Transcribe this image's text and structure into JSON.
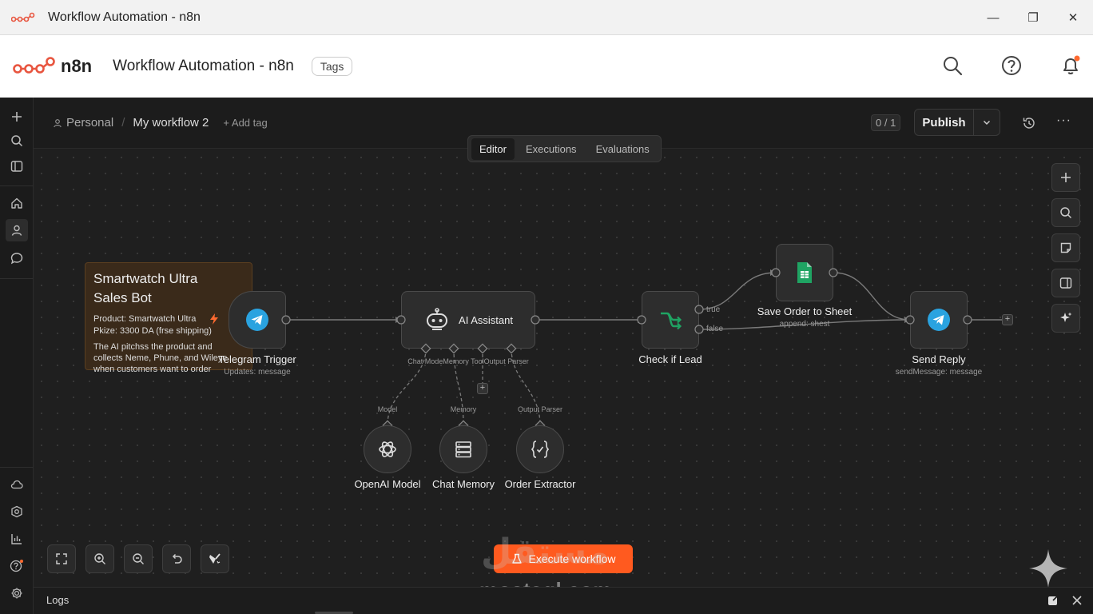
{
  "window": {
    "title": "Workflow Automation - n8n",
    "controls": [
      "minimize",
      "maximize",
      "close"
    ]
  },
  "app_header": {
    "brand": "n8n",
    "title": "Workflow Automation - n8n",
    "tags_button": "Tags",
    "icons": [
      "search-icon",
      "help-icon",
      "bell-icon"
    ]
  },
  "sidebar": {
    "top_icons": [
      "plus-icon",
      "search-icon",
      "panel-icon",
      "home-icon",
      "user-icon",
      "chat-icon"
    ],
    "bottom_icons": [
      "cloud-icon",
      "templates-icon",
      "insights-icon",
      "help-icon",
      "settings-icon"
    ]
  },
  "topbar": {
    "breadcrumb_owner": "Personal",
    "breadcrumb_sep": "/",
    "workflow_name": "My workflow 2",
    "add_tag": "+ Add tag",
    "counter": "0 / 1",
    "publish": "Publish",
    "more": "···"
  },
  "tabs": [
    "Editor",
    "Executions",
    "Evaluations"
  ],
  "active_tab": "Editor",
  "sticky_note": {
    "title": "Smartwatch Ultra Sales Bot",
    "line1": "Product: Smartwatch Ultra",
    "line2": "Pkize: 3300 DA (frse shipping)",
    "line3": "The AI pitchss the product and collects Neme, Phune, and Wileye when customers want to order"
  },
  "nodes": {
    "telegram_trigger": {
      "label": "Telegram Trigger",
      "sub": "Updates: message"
    },
    "ai_assistant": {
      "label": "AI Assistant",
      "ports": "Chat ModeMemory   ToolOutput Parser"
    },
    "check_if_lead": {
      "label": "Check if Lead",
      "true": "true",
      "false": "false"
    },
    "save_order": {
      "label": "Save Order to Sheet",
      "sub": "append: shest"
    },
    "send_reply": {
      "label": "Send Reply",
      "sub": "sendMessage: message"
    },
    "openai_model": {
      "label": "OpenAI Model",
      "port": "Model"
    },
    "chat_memory": {
      "label": "Chat Memory",
      "port": "Memory"
    },
    "order_extractor": {
      "label": "Order Extractor",
      "port": "Output Parser"
    }
  },
  "plus": "+",
  "execute_button": "Execute workflow",
  "watermark": {
    "arabic": "مستقل",
    "latin": "mostaql.com"
  },
  "logs": "Logs",
  "colors": {
    "accent": "#ff5a1f",
    "telegram": "#2aa3e0",
    "sheets": "#1fa463",
    "canvas": "#1f1f1f"
  }
}
